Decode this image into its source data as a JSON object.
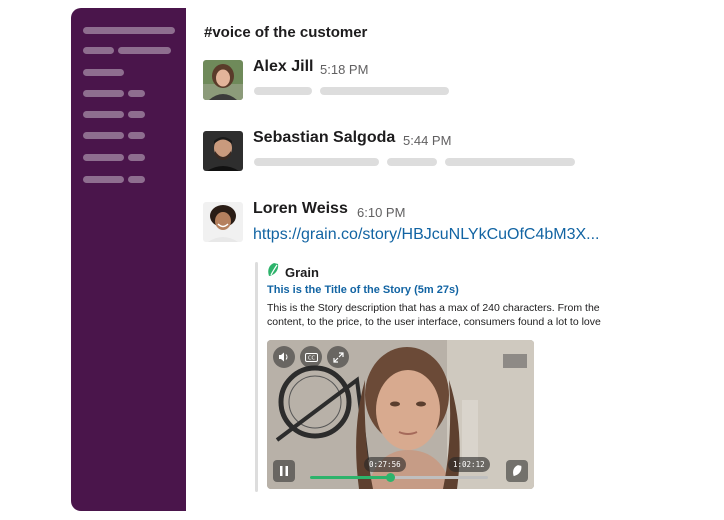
{
  "channel": {
    "name": "#voice of the customer"
  },
  "messages": [
    {
      "author": "Alex Jill",
      "time": "5:18 PM"
    },
    {
      "author": "Sebastian Salgoda",
      "time": "5:44 PM"
    },
    {
      "author": "Loren Weiss",
      "time": "6:10 PM",
      "link": "https://grain.co/story/HBJcuNLYkCuOfC4bM3X..."
    }
  ],
  "attachment": {
    "app_name": "Grain",
    "story_title": "This is the Title of the Story  (5m 27s)",
    "description": "This is the Story description that has a max of 240 characters. From the content, to the price, to the user interface, consumers found a lot to love",
    "video": {
      "current_time": "0:27:56",
      "duration": "1:02:12",
      "progress": 0.45,
      "controls": [
        "volume-icon",
        "captions-icon",
        "fullscreen-icon",
        "pause-icon",
        "grain-logo-icon"
      ]
    }
  },
  "colors": {
    "sidebar": "#4a154b",
    "link": "#1264a3",
    "progress": "#2db36b"
  }
}
